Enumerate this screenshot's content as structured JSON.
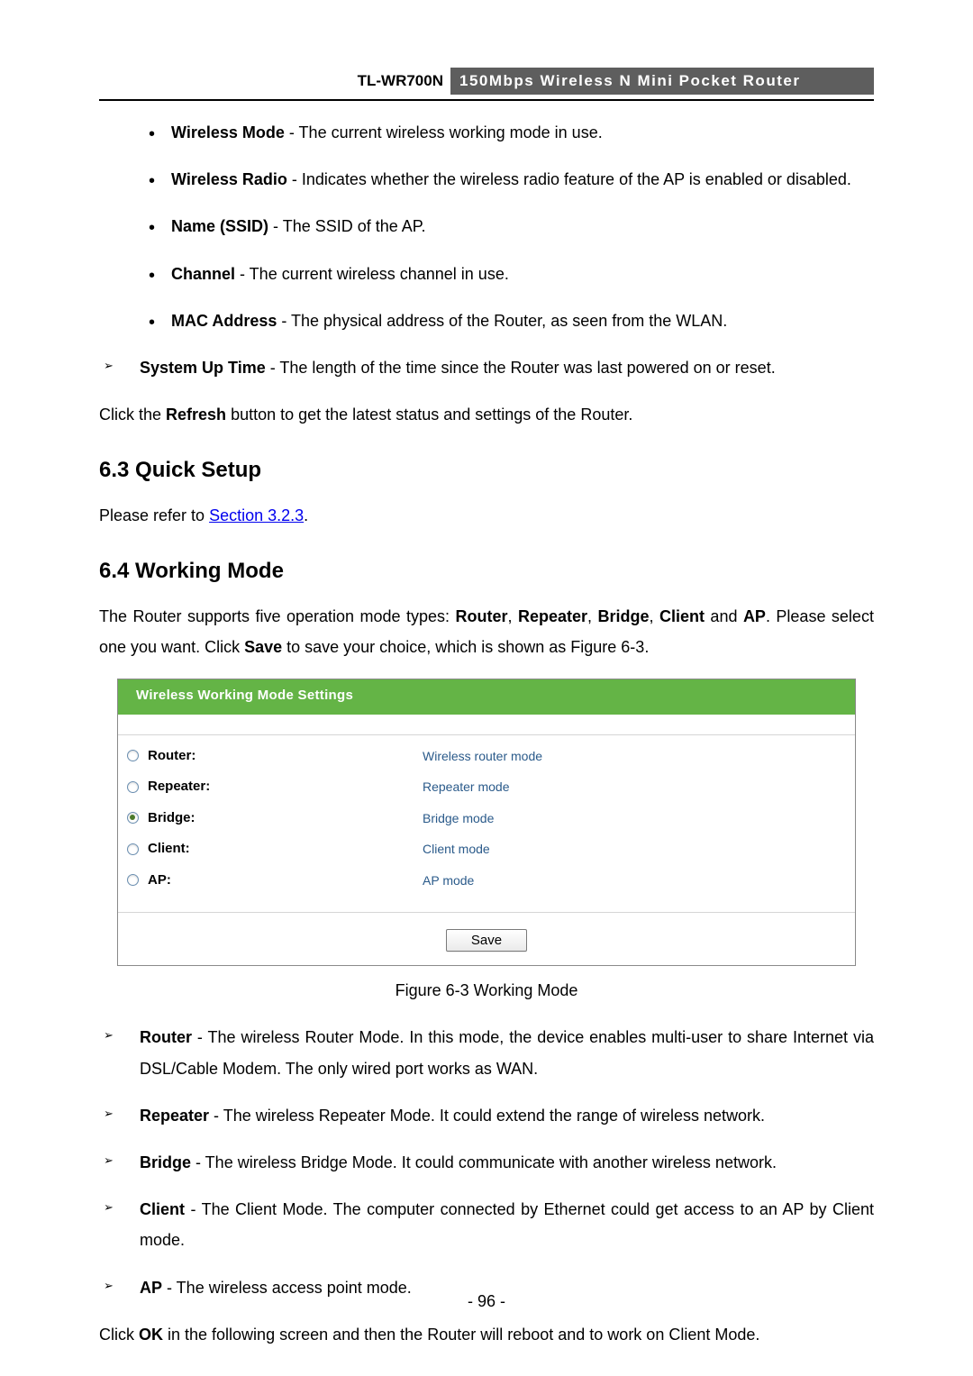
{
  "header": {
    "model": "TL-WR700N",
    "product": "150Mbps Wireless N Mini Pocket Router"
  },
  "bullets_top": [
    {
      "label": "Wireless Mode",
      "text": " - The current wireless working mode in use."
    },
    {
      "label": "Wireless Radio",
      "text": " - Indicates whether the wireless radio feature of the AP is enabled or disabled."
    },
    {
      "label": "Name (SSID)",
      "text": " - The SSID of the AP."
    },
    {
      "label": "Channel",
      "text": " - The current wireless channel in use."
    },
    {
      "label": "MAC Address",
      "text": " - The physical address of the Router, as seen from the WLAN."
    }
  ],
  "arrow_top": {
    "label": "System Up Time",
    "text": " - The length of the time since the Router was last powered on or reset."
  },
  "refresh_sentence": {
    "pre": "Click the ",
    "b": "Refresh",
    "post": " button to get the latest status and settings of the Router."
  },
  "section63": {
    "heading": "6.3  Quick Setup",
    "pre": "Please refer to ",
    "link": "Section 3.2.3",
    "post": "."
  },
  "section64": {
    "heading": "6.4  Working Mode",
    "intro_parts": {
      "p1": "The Router supports five operation mode types: ",
      "b1": "Router",
      "c1": ", ",
      "b2": "Repeater",
      "c2": ", ",
      "b3": "Bridge",
      "c3": ", ",
      "b4": "Client",
      "c4": " and ",
      "b5": "AP",
      "p2": ". Please select one you want. Click ",
      "b6": "Save",
      "p3": " to save your choice, which is shown as Figure 6-3."
    }
  },
  "panel": {
    "title": "Wireless Working Mode Settings",
    "rows": [
      {
        "label": "Router:",
        "desc": "Wireless router mode",
        "checked": false
      },
      {
        "label": "Repeater:",
        "desc": "Repeater mode",
        "checked": false
      },
      {
        "label": "Bridge:",
        "desc": "Bridge mode",
        "checked": true
      },
      {
        "label": "Client:",
        "desc": "Client mode",
        "checked": false
      },
      {
        "label": "AP:",
        "desc": "AP mode",
        "checked": false
      }
    ],
    "save": "Save"
  },
  "figure_caption": "Figure 6-3 Working Mode",
  "arrow_bottom": [
    {
      "label": "Router",
      "text": " - The wireless Router Mode. In this mode, the device enables multi-user to share Internet via DSL/Cable Modem. The only wired port works as WAN."
    },
    {
      "label": "Repeater",
      "text": " - The wireless Repeater Mode. It could extend the range of wireless network."
    },
    {
      "label": "Bridge",
      "text": " - The wireless Bridge Mode. It could communicate with another wireless network."
    },
    {
      "label": "Client",
      "text": " - The Client Mode. The computer connected by Ethernet could get access to an AP by Client mode."
    },
    {
      "label": "AP",
      "text": " - The wireless access point mode."
    }
  ],
  "closing": {
    "pre": "Click ",
    "b": "OK",
    "post": " in the following screen and then the Router will reboot and to work on Client Mode."
  },
  "page_number": "- 96 -"
}
